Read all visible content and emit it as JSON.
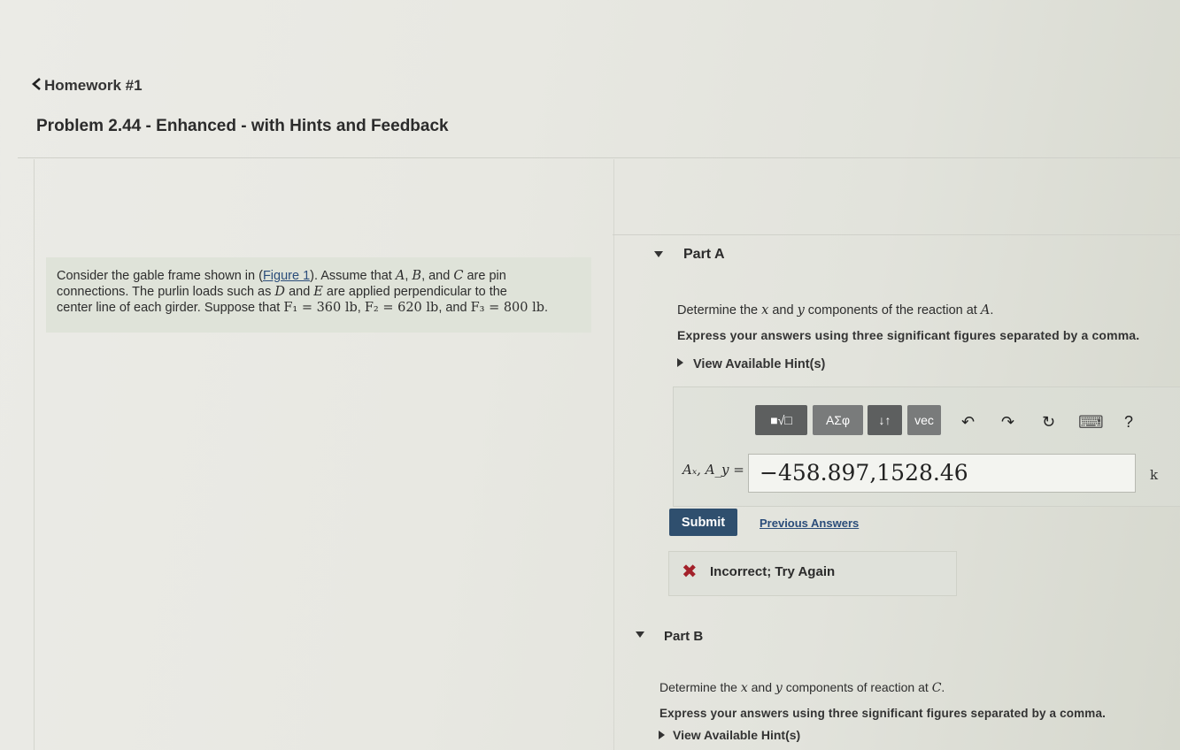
{
  "nav": {
    "back_label": "Homework #1"
  },
  "page_title": "Problem 2.44 - Enhanced - with Hints and Feedback",
  "problem": {
    "line1_pre": "Consider the gable frame shown in (",
    "figure_link": "Figure 1",
    "line1_post": "). Assume that",
    "sym_A": "A",
    "sym_B": "B",
    "sym_C": "C",
    "line1_tail": "are pin",
    "line2_pre": "connections. The purlin loads such as",
    "sym_D": "D",
    "line2_mid": "and",
    "sym_E": "E",
    "line2_post": "are applied perpendicular to the",
    "line3_pre": "center line of each girder. Suppose that",
    "F1": "F₁ = 360 lb",
    "F2": "F₂ = 620 lb",
    "line3_and": ", and",
    "F3": "F₃ = 800 lb",
    "line3_end": "."
  },
  "part_a": {
    "label": "Part A",
    "question_pre": "Determine the",
    "var_x": "x",
    "question_mid": "and",
    "var_y": "y",
    "question_post": "components of the reaction at",
    "point": "A",
    "instructions": "Express your answers using three significant figures separated by a comma.",
    "hint_label": "View Available Hint(s)",
    "toolbar": {
      "templates_label": "■√□",
      "greek_label": "ΑΣφ",
      "arrows_label": "↓↑",
      "vec_label": "vec",
      "undo_icon": "↶",
      "redo_icon": "↷",
      "reset_icon": "↻",
      "keyboard_icon": "⌨",
      "help_label": "?"
    },
    "answer_label": "Aₓ, A_y =",
    "answer_value": "−458.897,1528.46",
    "unit": "k",
    "submit_label": "Submit",
    "previous_answers_label": "Previous Answers",
    "feedback_text": "Incorrect; Try Again"
  },
  "part_b": {
    "label": "Part B",
    "question_pre": "Determine the",
    "var_x": "x",
    "question_mid": "and",
    "var_y": "y",
    "question_post": "components of reaction at",
    "point": "C",
    "instructions": "Express your answers using three significant figures separated by a comma.",
    "hint_label": "View Available Hint(s)"
  }
}
